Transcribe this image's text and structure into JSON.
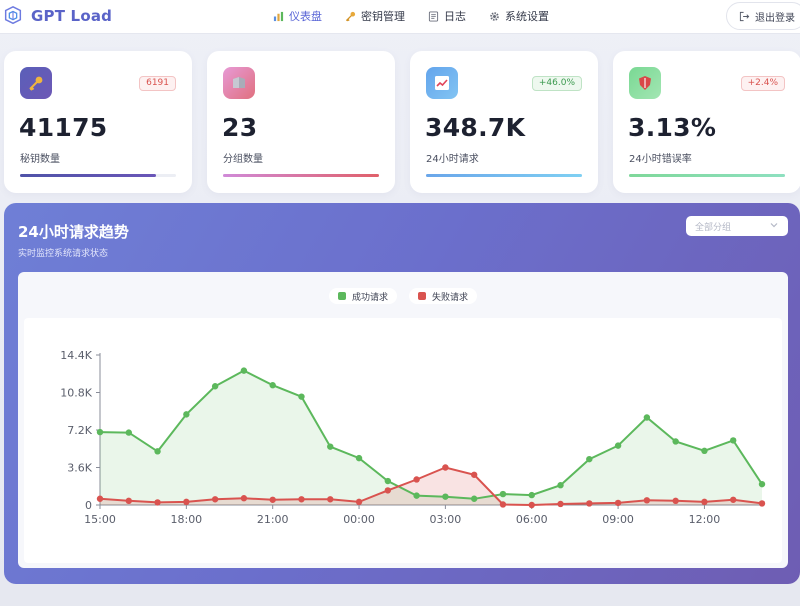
{
  "header": {
    "app_name": "GPT Load",
    "nav": [
      {
        "label": "仪表盘",
        "icon": "bar-chart-icon",
        "active": true
      },
      {
        "label": "密钥管理",
        "icon": "key-icon",
        "active": false
      },
      {
        "label": "日志",
        "icon": "document-icon",
        "active": false
      },
      {
        "label": "系统设置",
        "icon": "gear-icon",
        "active": false
      }
    ],
    "logout_label": "退出登录"
  },
  "stats": [
    {
      "value": "41175",
      "label": "秘钥数量",
      "badge": "6191",
      "badge_tone": "red",
      "icon": "key-icon",
      "progress": 0.87,
      "colors": [
        "#4f53a8",
        "#6a56b8"
      ]
    },
    {
      "value": "23",
      "label": "分组数量",
      "badge": "",
      "badge_tone": "",
      "icon": "folder-icon",
      "progress": 1.0,
      "colors": [
        "#d08ad8",
        "#e0606a"
      ]
    },
    {
      "value": "348.7K",
      "label": "24小时请求",
      "badge": "+46.0%",
      "badge_tone": "green",
      "icon": "trend-up-icon",
      "progress": 1.0,
      "colors": [
        "#6aa6ea",
        "#7fd0f3"
      ]
    },
    {
      "value": "3.13%",
      "label": "24小时错误率",
      "badge": "+2.4%",
      "badge_tone": "red",
      "icon": "shield-icon",
      "progress": 1.0,
      "colors": [
        "#7fd89a",
        "#8ee0c0"
      ]
    }
  ],
  "trend": {
    "title": "24小时请求趋势",
    "subtitle": "实时监控系统请求状态",
    "group_select": "全部分组"
  },
  "chart_data": {
    "type": "line",
    "x": [
      "15:00",
      "16:00",
      "17:00",
      "18:00",
      "19:00",
      "20:00",
      "21:00",
      "22:00",
      "23:00",
      "00:00",
      "01:00",
      "02:00",
      "03:00",
      "04:00",
      "05:00",
      "06:00",
      "07:00",
      "08:00",
      "09:00",
      "10:00",
      "11:00",
      "12:00",
      "13:00",
      "14:00"
    ],
    "xticks": [
      "15:00",
      "18:00",
      "21:00",
      "00:00",
      "03:00",
      "06:00",
      "09:00",
      "12:00"
    ],
    "yticks": [
      "0",
      "3.6K",
      "7.2K",
      "10.8K",
      "14.4K"
    ],
    "ylim": [
      0,
      14400
    ],
    "series": [
      {
        "name": "成功请求",
        "color": "#5cb85c",
        "values": [
          7000,
          6950,
          5150,
          8700,
          11400,
          12900,
          11500,
          10400,
          5600,
          4500,
          2300,
          900,
          800,
          600,
          1050,
          950,
          1900,
          4400,
          5700,
          8400,
          6100,
          5200,
          6200,
          2000
        ]
      },
      {
        "name": "失败请求",
        "color": "#d9534f",
        "values": [
          600,
          400,
          250,
          300,
          550,
          650,
          500,
          550,
          550,
          300,
          1400,
          2450,
          3600,
          2900,
          50,
          0,
          100,
          150,
          200,
          450,
          400,
          300,
          500,
          150
        ]
      }
    ]
  }
}
